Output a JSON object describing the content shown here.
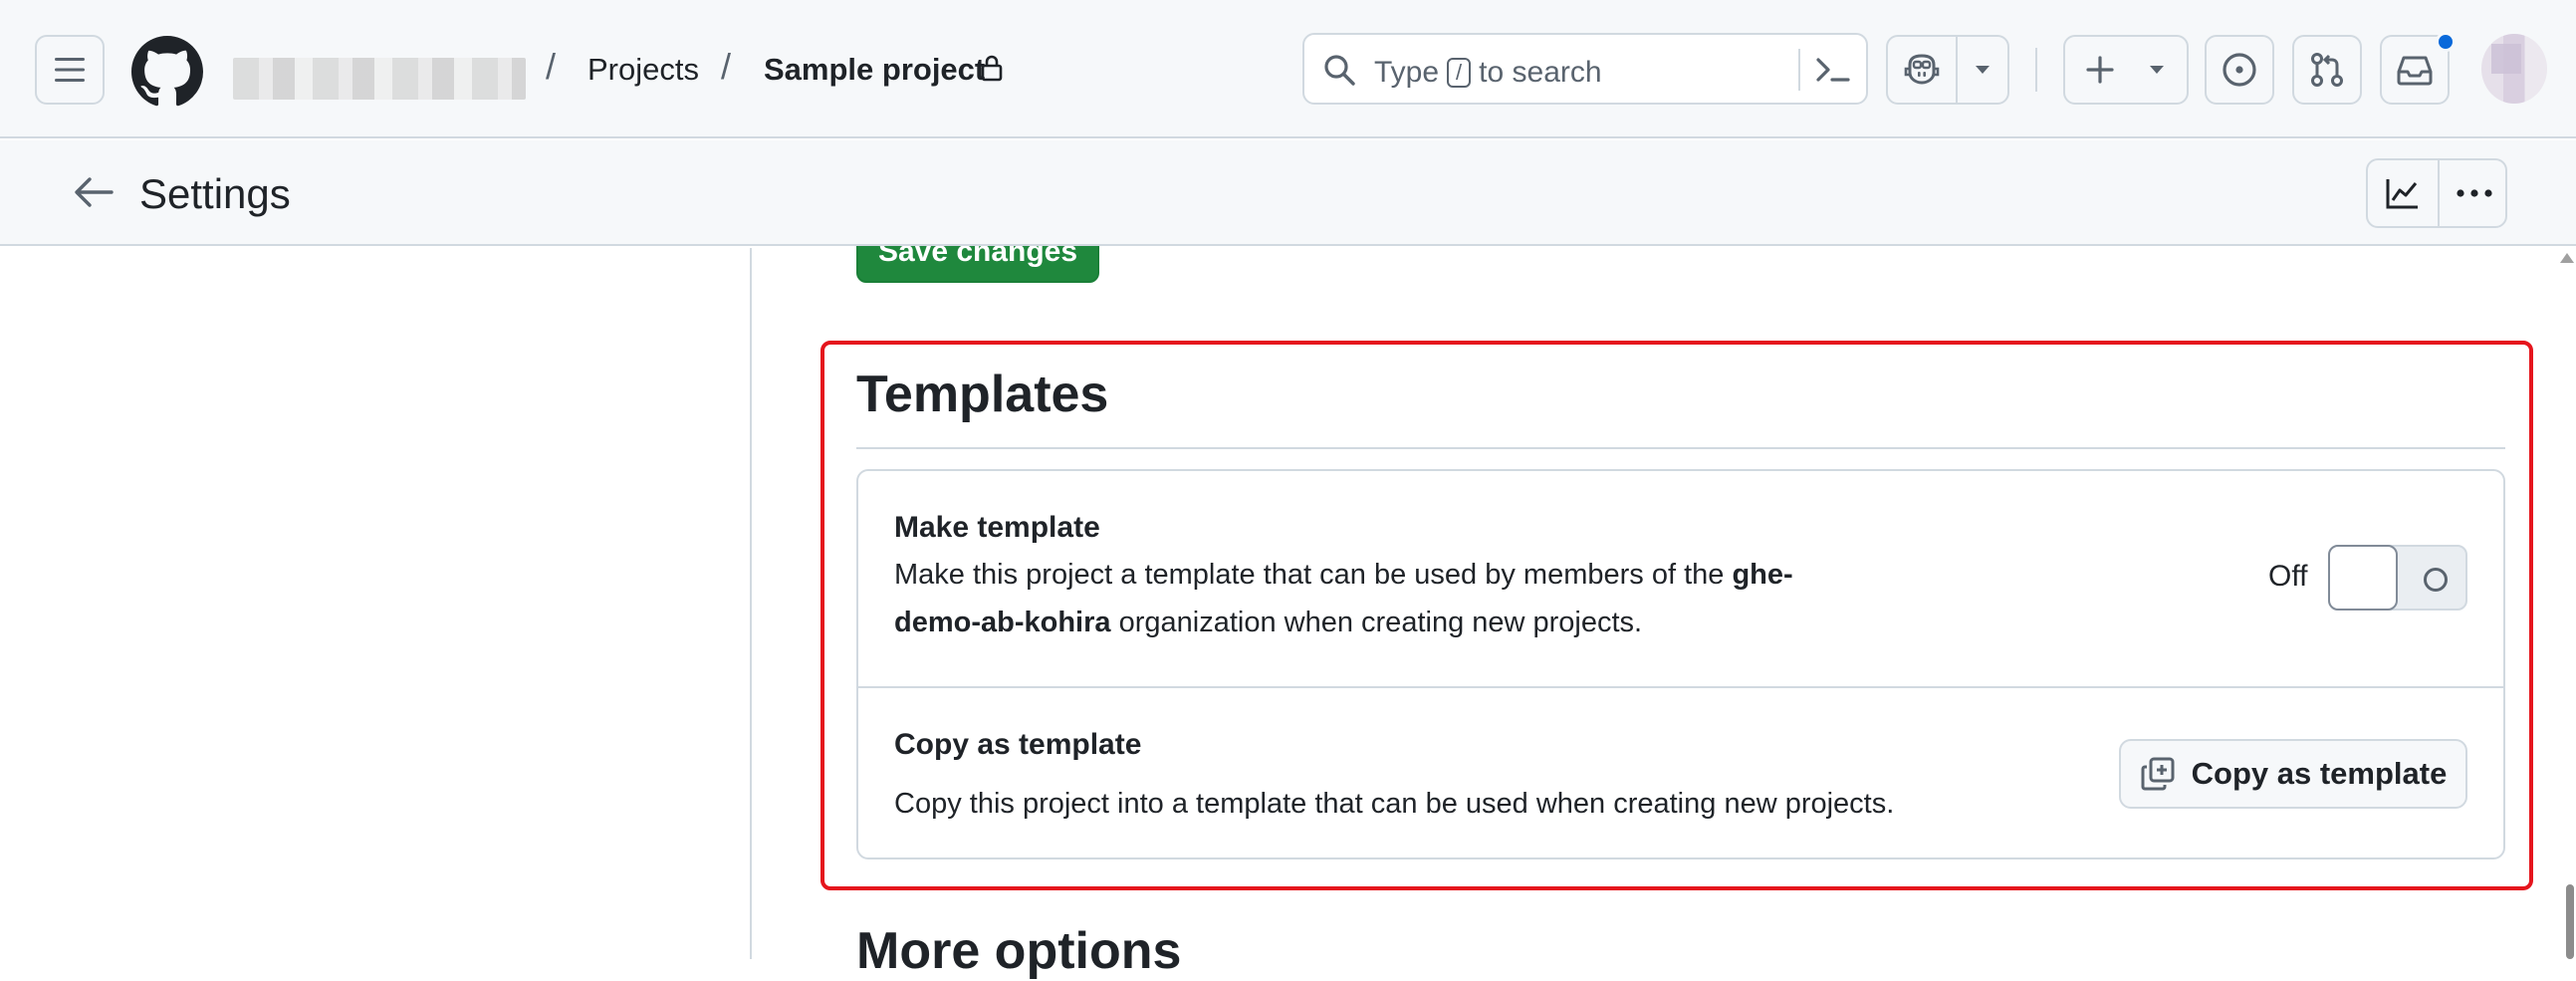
{
  "header": {
    "breadcrumb_sep": "/",
    "projects": "Projects",
    "project_name": "Sample project",
    "search_type": "Type",
    "search_key": "/",
    "search_rest": "to search"
  },
  "subheader": {
    "title": "Settings"
  },
  "content": {
    "save_label": "Save changes",
    "templates_heading": "Templates",
    "make_template": {
      "title": "Make template",
      "desc_before": "Make this project a template that can be used by members of the ",
      "org_part1": "ghe-",
      "org_part2": "demo-ab-kohira",
      "desc_after": " organization when creating new projects.",
      "toggle_state": "Off"
    },
    "copy_template": {
      "title": "Copy as template",
      "desc": "Copy this project into a template that can be used when creating new projects.",
      "button_label": "Copy as template"
    },
    "more_options": "More options"
  },
  "colors": {
    "accent_green": "#1f883d",
    "highlight_red": "#e5151d",
    "notification_blue": "#0969da"
  },
  "icons": [
    "hamburger-icon",
    "github-logo-icon",
    "lock-icon",
    "search-icon",
    "command-palette-icon",
    "copilot-icon",
    "chevron-down-icon",
    "plus-icon",
    "issues-icon",
    "pull-requests-icon",
    "inbox-icon",
    "arrow-left-icon",
    "insights-graph-icon",
    "kebab-icon",
    "copy-icon"
  ]
}
